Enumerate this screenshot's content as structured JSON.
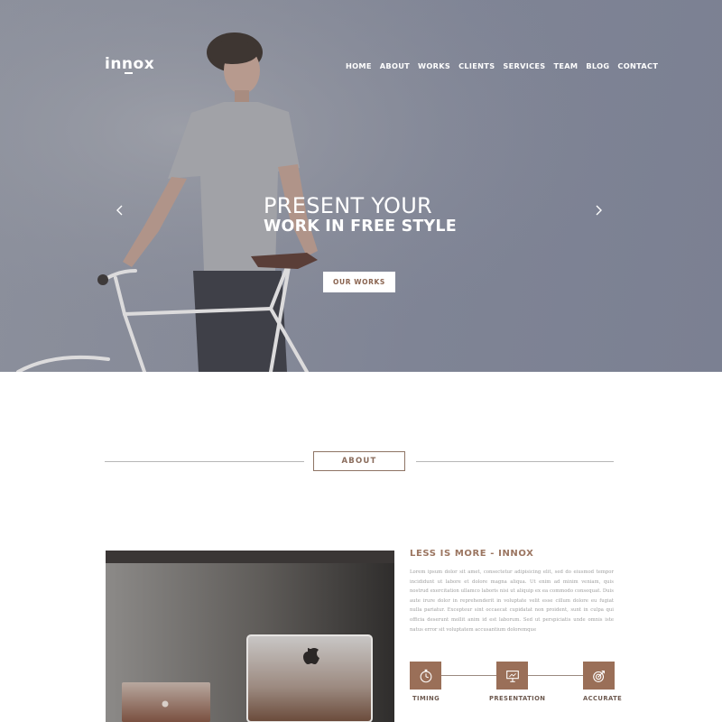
{
  "header": {
    "logo": "innox",
    "nav": [
      "HOME",
      "ABOUT",
      "WORKS",
      "CLIENTS",
      "SERVICES",
      "TEAM",
      "BLOG",
      "CONTACT"
    ]
  },
  "hero": {
    "line1": "PRESENT YOUR",
    "line2": "WORK IN FREE STYLE",
    "cta_label": "OUR WORKS",
    "prev_icon": "chevron-left-icon",
    "next_icon": "chevron-right-icon"
  },
  "about": {
    "section_label": "ABOUT",
    "title": "LESS IS MORE - INNOX",
    "body": "Lorem ipsum dolor sit amet, consectetur adipisicing elit, sed do eiusmod tempor incididunt ut labore et dolore magna aliqua. Ut enim ad minim veniam, quis nostrud exercitation ullamco laboris nisi ut aliquip ex ea commodo consequat. Duis aute irure dolor in reprehenderit in voluptate velit esse cillum dolore eu fugiat nulla pariatur. Excepteur sint occaecat cupidatat non proident, sunt in culpa qui officia deserunt mollit anim id est laborum. Sed ut perspiciatis unde omnis iste natus error sit voluptatem accusantium doloremque",
    "features": [
      {
        "label": "TIMING",
        "icon": "stopwatch-icon"
      },
      {
        "label": "PRESENTATION",
        "icon": "presentation-icon"
      },
      {
        "label": "ACCURATE",
        "icon": "target-icon"
      }
    ]
  },
  "colors": {
    "accent": "#9a6f58",
    "hero_overlay": "#858999",
    "text_muted": "#a0a0a0"
  }
}
